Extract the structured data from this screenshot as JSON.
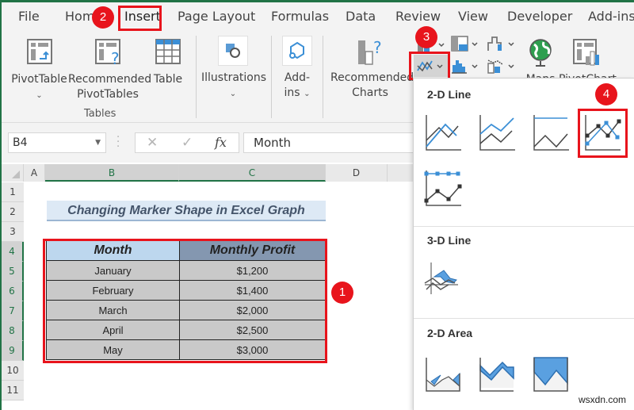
{
  "ribbon_tabs": [
    "File",
    "Home",
    "Insert",
    "Page Layout",
    "Formulas",
    "Data",
    "Review",
    "View",
    "Developer",
    "Add-ins"
  ],
  "active_tab": "Insert",
  "ribbon": {
    "pivottable": "PivotTable",
    "recommended_pivottables_1": "Recommended",
    "recommended_pivottables_2": "PivotTables",
    "table": "Table",
    "tables_group": "Tables",
    "illustrations": "Illustrations",
    "addins_1": "Add-",
    "addins_2": "ins",
    "recommended_charts_1": "Recommended",
    "recommended_charts_2": "Charts",
    "maps": "Maps",
    "pivotchart": "PivotChart",
    "caret": "⌄"
  },
  "formula_bar": {
    "name_box": "B4",
    "cancel": "✕",
    "enter": "✓",
    "fx": "fx",
    "value": "Month"
  },
  "columns": [
    "A",
    "B",
    "C",
    "D"
  ],
  "rows": [
    "1",
    "2",
    "3",
    "4",
    "5",
    "6",
    "7",
    "8",
    "9",
    "10",
    "11"
  ],
  "sheet": {
    "title": "Changing Marker Shape in Excel Graph",
    "headers": [
      "Month",
      "Monthly Profit"
    ],
    "data": [
      [
        "January",
        "$1,200"
      ],
      [
        "February",
        "$1,400"
      ],
      [
        "March",
        "$2,000"
      ],
      [
        "April",
        "$2,500"
      ],
      [
        "May",
        "$3,000"
      ]
    ]
  },
  "badges": [
    "1",
    "2",
    "3",
    "4"
  ],
  "gallery": {
    "section_2d_line": "2-D Line",
    "section_3d_line": "3-D Line",
    "section_2d_area": "2-D Area"
  },
  "colors": {
    "excel_green": "#217346",
    "highlight_red": "#e8141c",
    "header_blue": "#bdd7ee",
    "header_slate": "#8497b0",
    "chart_blue": "#3b8fd6"
  },
  "watermark": "wsxdn.com"
}
